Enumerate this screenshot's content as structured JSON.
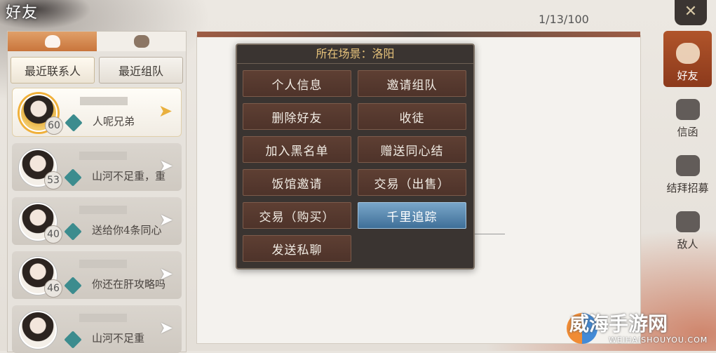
{
  "window": {
    "title": "好友",
    "page_count": "1/13/100",
    "close_icon": "crossed-swords-icon"
  },
  "left_panel": {
    "category_tabs": [
      {
        "icon": "pouch-icon",
        "active": true
      },
      {
        "icon": "people-icon",
        "active": false
      }
    ],
    "sub_tabs": [
      {
        "label": "最近联系人",
        "active": true
      },
      {
        "label": "最近组队",
        "active": false
      }
    ],
    "contacts": [
      {
        "level": "60",
        "message": "人呢兄弟",
        "selected": true
      },
      {
        "level": "53",
        "message": "山河不足重，重",
        "selected": false
      },
      {
        "level": "40",
        "message": "送给你4条同心",
        "selected": false
      },
      {
        "level": "46",
        "message": "你还在肝攻略吗",
        "selected": false
      },
      {
        "level": "",
        "message": "山河不足重",
        "selected": false
      }
    ]
  },
  "popup": {
    "title": "所在场景：洛阳",
    "buttons": [
      {
        "label": "个人信息",
        "active": false
      },
      {
        "label": "邀请组队",
        "active": false
      },
      {
        "label": "删除好友",
        "active": false
      },
      {
        "label": "收徒",
        "active": false
      },
      {
        "label": "加入黑名单",
        "active": false
      },
      {
        "label": "赠送同心结",
        "active": false
      },
      {
        "label": "饭馆邀请",
        "active": false
      },
      {
        "label": "交易（出售）",
        "active": false
      },
      {
        "label": "交易（购买）",
        "active": false
      },
      {
        "label": "千里追踪",
        "active": true
      },
      {
        "label": "发送私聊",
        "active": false
      }
    ]
  },
  "right_nav": [
    {
      "label": "好友",
      "icon": "friends-icon",
      "active": true
    },
    {
      "label": "信函",
      "icon": "letter-icon",
      "active": false
    },
    {
      "label": "结拜招募",
      "icon": "sworn-brothers-icon",
      "active": false
    },
    {
      "label": "敌人",
      "icon": "enemy-icon",
      "active": false
    }
  ],
  "watermark": {
    "text": "威海手游网",
    "sub": "WEIHAISHOUYOU.COM"
  },
  "colors": {
    "popup_bg": "#3a3431",
    "button_bg": "#5e3f33",
    "active_button": "#3f6f98",
    "title_gold": "#e6c27a",
    "nav_active": "#b0542a"
  }
}
